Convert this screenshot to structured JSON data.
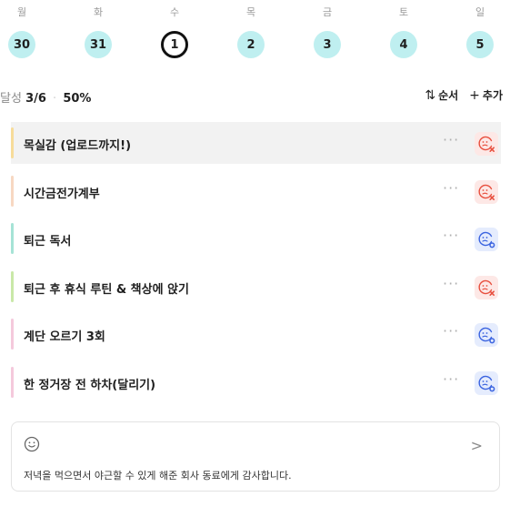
{
  "week": {
    "days": [
      {
        "label": "월",
        "date": "30",
        "today": false
      },
      {
        "label": "화",
        "date": "31",
        "today": false
      },
      {
        "label": "수",
        "date": "1",
        "today": true
      },
      {
        "label": "목",
        "date": "2",
        "today": false
      },
      {
        "label": "금",
        "date": "3",
        "today": false
      },
      {
        "label": "토",
        "date": "4",
        "today": false
      },
      {
        "label": "일",
        "date": "5",
        "today": false
      }
    ]
  },
  "progress": {
    "prefix": "달성",
    "count": "3/6",
    "separator": "·",
    "percent": "50%"
  },
  "toolbar": {
    "order_label": "순서",
    "order_icon": "sort-arrows-icon",
    "add_label": "추가",
    "add_icon": "plus-icon"
  },
  "tasks": [
    {
      "title": "목실감 (업로드까지!)",
      "color": "#f7dc9a",
      "status": "fail",
      "selected": true
    },
    {
      "title": "시간금전가계부",
      "color": "#f7d8c2",
      "status": "fail",
      "selected": false
    },
    {
      "title": "퇴근 독서",
      "color": "#a6e3d6",
      "status": "ok",
      "selected": false
    },
    {
      "title": "퇴근 후 휴식 루틴 & 책상에 앉기",
      "color": "#c9e8a8",
      "status": "fail",
      "selected": false
    },
    {
      "title": "계단 오르기 3회",
      "color": "#f4c9dc",
      "status": "ok",
      "selected": false
    },
    {
      "title": "한 정거장 전 하차(달리기)",
      "color": "#f4c9dc",
      "status": "ok",
      "selected": false
    }
  ],
  "colors": {
    "date_bg": "#bfeff0",
    "fail_icon": "#e8503f",
    "fail_bg": "#fde8e6",
    "ok_icon": "#3b64e0",
    "ok_bg": "#e5ecfd"
  },
  "gratitude": {
    "icon": "smile-icon",
    "text": "저녁을 먹으면서 야근할 수 있게 해준 회사 동료에게 감사합니다."
  }
}
